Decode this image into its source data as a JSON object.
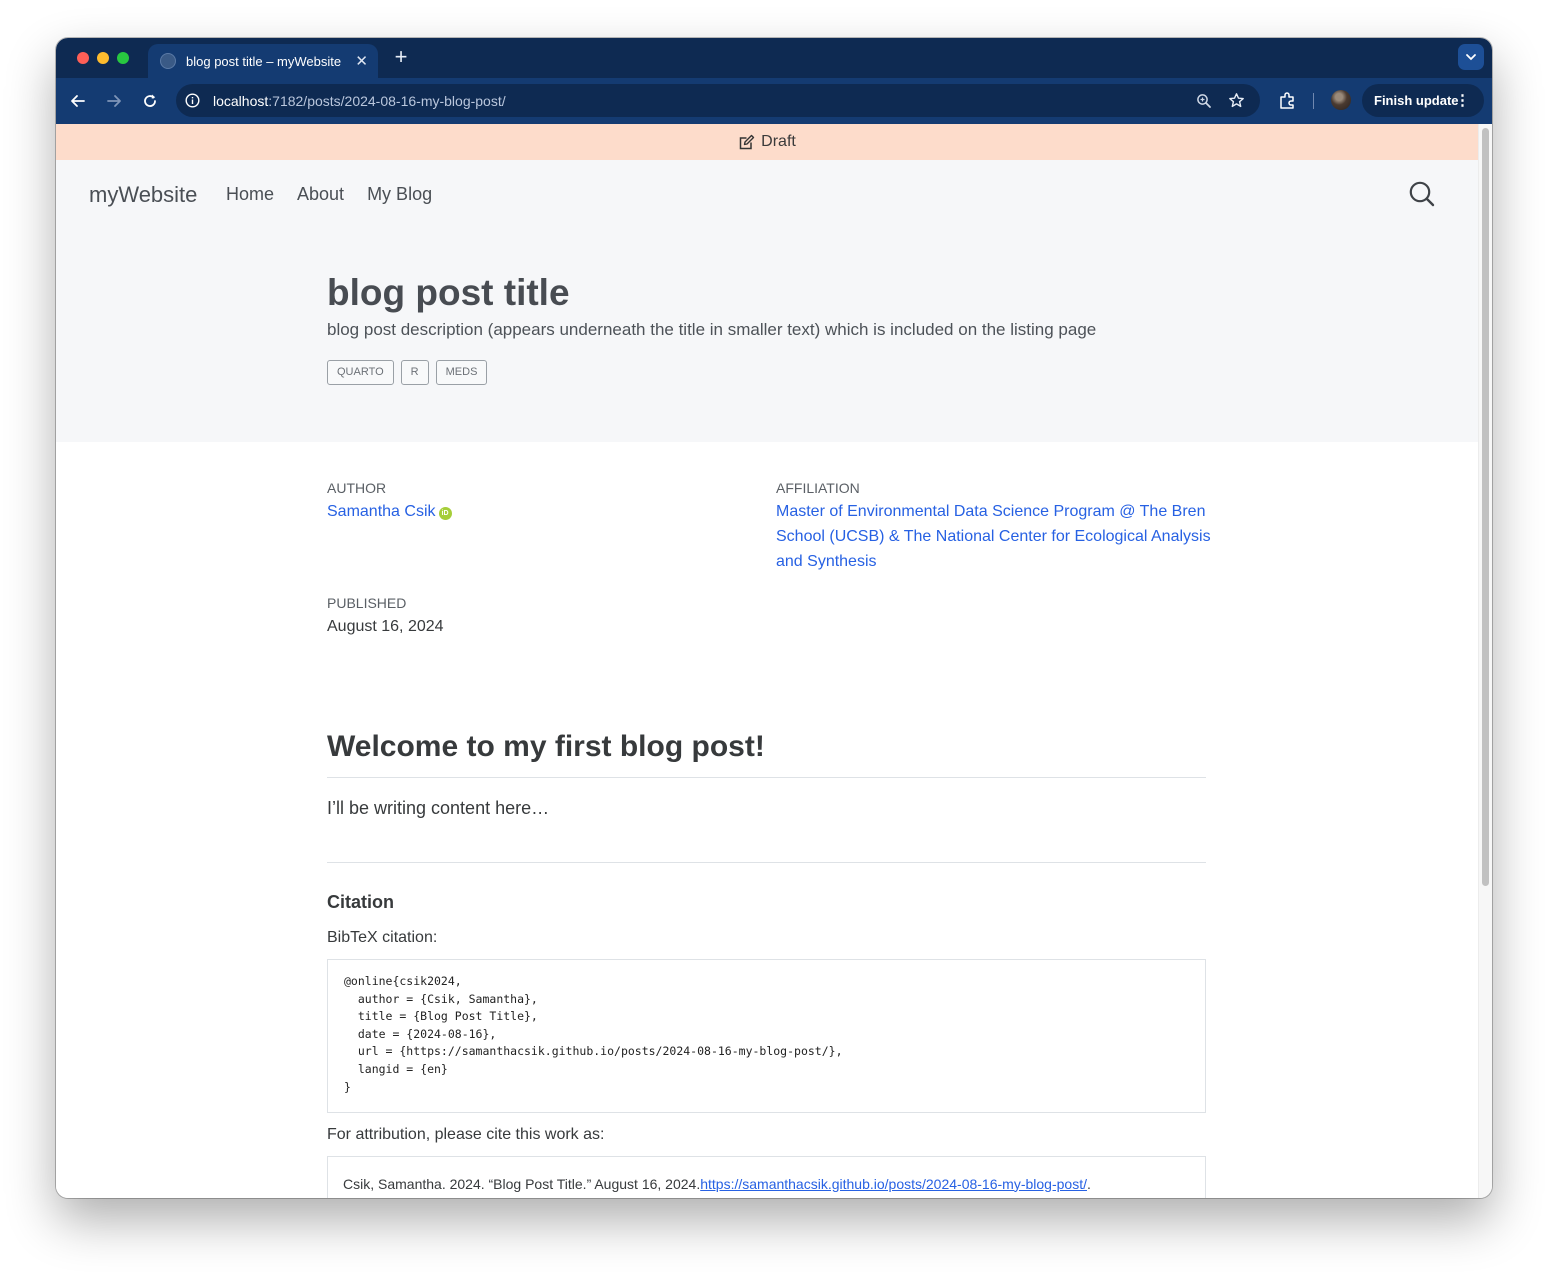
{
  "browser": {
    "tab_title": "blog post title – myWebsite",
    "new_tab_icon": "+",
    "url_host": "localhost",
    "url_rest": ":7182/posts/2024-08-16-my-blog-post/",
    "finish_update_label": "Finish update"
  },
  "draft_banner": {
    "label": "Draft"
  },
  "navbar": {
    "brand": "myWebsite",
    "links": [
      "Home",
      "About",
      "My Blog"
    ]
  },
  "post": {
    "title": "blog post title",
    "description": "blog post description (appears underneath the title in smaller text) which is included on the listing page",
    "categories": [
      "QUARTO",
      "R",
      "MEDS"
    ]
  },
  "meta": {
    "author_label": "AUTHOR",
    "author_name": "Samantha Csik",
    "orcid_badge": "iD",
    "affiliation_label": "AFFILIATION",
    "affiliation_lines": [
      "Master of Environmental Data Science Program @ The Bren",
      "School (UCSB) & The National Center for Ecological Analysis",
      "and Synthesis"
    ],
    "published_label": "PUBLISHED",
    "published_date": "August 16, 2024"
  },
  "content": {
    "heading": "Welcome to my first blog post!",
    "paragraph": "I’ll be writing content here…"
  },
  "citation": {
    "heading": "Citation",
    "bibtex_label": "BibTeX citation:",
    "bibtex": "@online{csik2024,\n  author = {Csik, Samantha},\n  title = {Blog Post Title},\n  date = {2024-08-16},\n  url = {https://samanthacsik.github.io/posts/2024-08-16-my-blog-post/},\n  langid = {en}\n}",
    "attribution_label": "For attribution, please cite this work as:",
    "attribution_text": "Csik, Samantha. 2024. “Blog Post Title.” August 16, 2024. ",
    "attribution_link": "https://samanthacsik.github.io/posts/2024-08-16-my-blog-post/",
    "attribution_end": "."
  },
  "colors": {
    "tab_strip": "#0e2a52",
    "toolbar": "#143b72",
    "draft_banner": "#fddccb",
    "link": "#2761e3"
  }
}
